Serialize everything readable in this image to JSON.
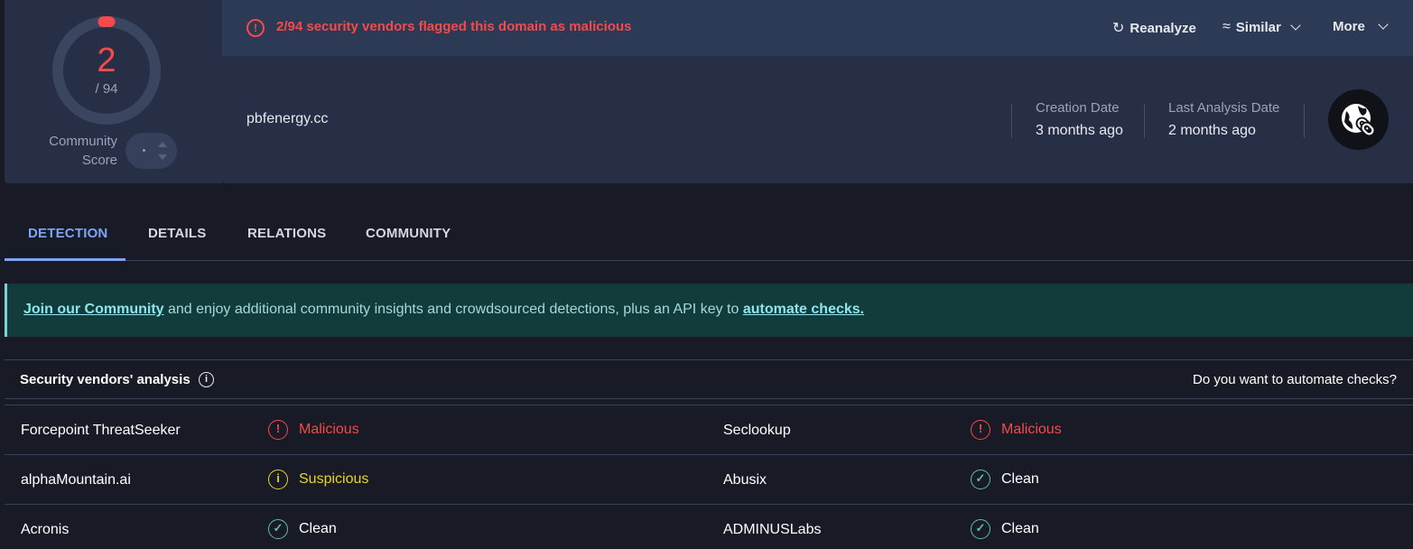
{
  "score": {
    "detections": "2",
    "total": "/ 94",
    "community_label": "Community Score",
    "community_vote_placeholder": "·"
  },
  "header": {
    "alert_text": "2/94 security vendors flagged this domain as malicious",
    "actions": {
      "reanalyze": "Reanalyze",
      "similar": "Similar",
      "more": "More"
    },
    "domain": "pbfenergy.cc",
    "creation_date_label": "Creation Date",
    "creation_date_value": "3 months ago",
    "last_analysis_label": "Last Analysis Date",
    "last_analysis_value": "2 months ago"
  },
  "tabs": [
    {
      "label": "DETECTION",
      "active": true
    },
    {
      "label": "DETAILS",
      "active": false
    },
    {
      "label": "RELATIONS",
      "active": false
    },
    {
      "label": "COMMUNITY",
      "active": false
    }
  ],
  "banner": {
    "link1": "Join our Community",
    "middle": " and enjoy additional community insights and crowdsourced detections, plus an API key to ",
    "link2": "automate checks."
  },
  "vendors": {
    "title": "Security vendors' analysis",
    "automate_question": "Do you want to automate checks?",
    "rows": [
      [
        {
          "name": "Forcepoint ThreatSeeker",
          "result": "Malicious"
        },
        {
          "name": "Seclookup",
          "result": "Malicious"
        }
      ],
      [
        {
          "name": "alphaMountain.ai",
          "result": "Suspicious"
        },
        {
          "name": "Abusix",
          "result": "Clean"
        }
      ],
      [
        {
          "name": "Acronis",
          "result": "Clean"
        },
        {
          "name": "ADMINUSLabs",
          "result": "Clean"
        }
      ]
    ]
  },
  "colors": {
    "malicious": "#f44a4a",
    "suspicious": "#e8d42b",
    "clean_icon": "#5ec0a1",
    "accent": "#7da4f5"
  }
}
